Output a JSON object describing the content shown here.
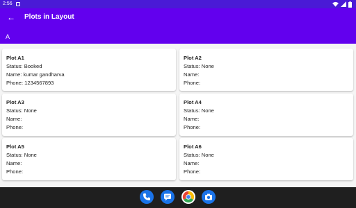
{
  "status_bar": {
    "time": "2:56"
  },
  "app_bar": {
    "title": "Plots in Layout"
  },
  "section": {
    "label": "A"
  },
  "plots": [
    {
      "name": "Plot A1",
      "status": "Status: Booked",
      "owner": "Name: kumar gandharva",
      "phone": "Phone: 1234567893"
    },
    {
      "name": "Plot A2",
      "status": "Status: None",
      "owner": "Name:",
      "phone": "Phone:"
    },
    {
      "name": "Plot A3",
      "status": "Status: None",
      "owner": "Name:",
      "phone": "Phone:"
    },
    {
      "name": "Plot A4",
      "status": "Status: None",
      "owner": "Name:",
      "phone": "Phone:"
    },
    {
      "name": "Plot A5",
      "status": "Status: None",
      "owner": "Name:",
      "phone": "Phone:"
    },
    {
      "name": "Plot A6",
      "status": "Status: None",
      "owner": "Name:",
      "phone": "Phone:"
    }
  ],
  "dock": {
    "apps": [
      {
        "icon": "phone-icon",
        "color": "#1a73e8"
      },
      {
        "icon": "messages-icon",
        "color": "#1a73e8"
      },
      {
        "icon": "chrome-icon",
        "color": "#ffffff"
      },
      {
        "icon": "camera-icon",
        "color": "#1a73e8"
      }
    ]
  },
  "colors": {
    "status_bar": "#4a1ad6",
    "app_bar": "#6200ee",
    "background": "#f5f5f5",
    "nav_bar": "#1f1f1f"
  }
}
